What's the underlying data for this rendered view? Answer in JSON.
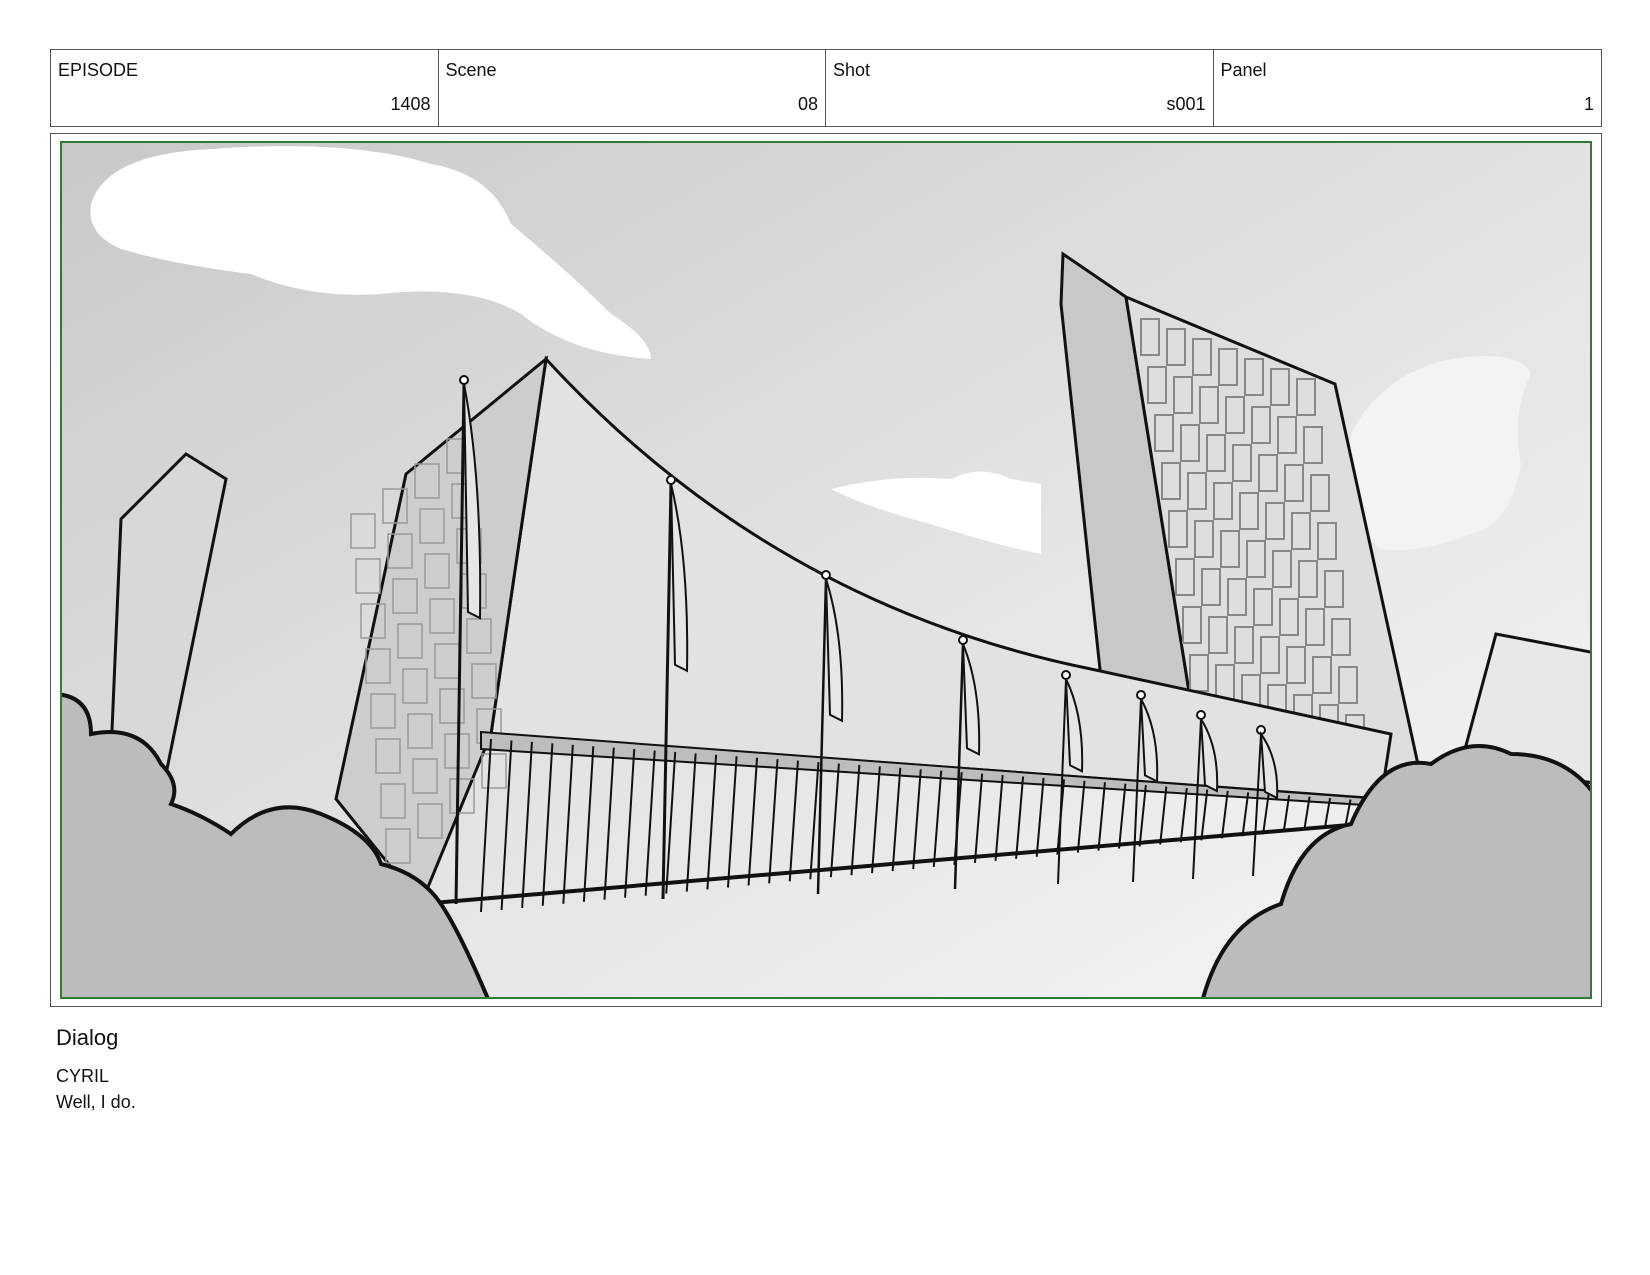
{
  "header": {
    "fields": [
      {
        "label": "EPISODE",
        "value": "1408"
      },
      {
        "label": "Scene",
        "value": "08"
      },
      {
        "label": "Shot",
        "value": "s001"
      },
      {
        "label": "Panel",
        "value": "1"
      }
    ]
  },
  "panel": {
    "frame_color": "#2e7d32",
    "drawing": "building-with-flags-sketch"
  },
  "dialog": {
    "heading": "Dialog",
    "character": "CYRIL",
    "line": "Well, I do."
  }
}
